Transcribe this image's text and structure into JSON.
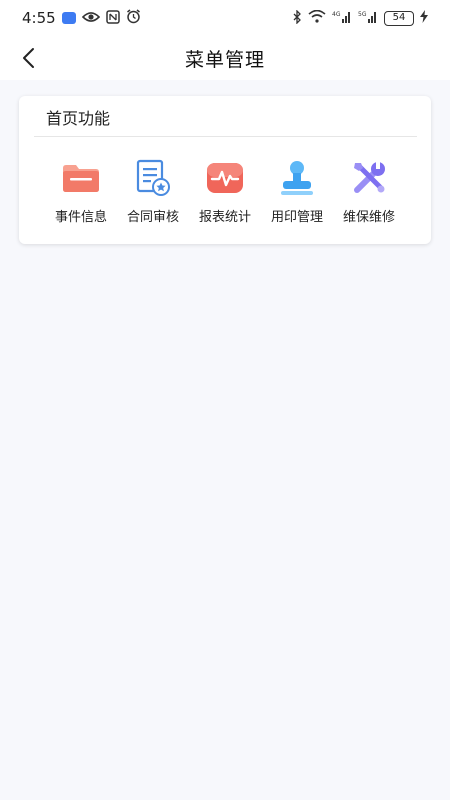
{
  "status_bar": {
    "time": "4:55",
    "battery": "54",
    "icons": [
      "app-notification-icon",
      "eye-icon",
      "nfc-icon",
      "alarm-icon",
      "bluetooth-icon",
      "wifi-icon",
      "signal-4g-icon",
      "signal-5g-icon",
      "charging-icon"
    ]
  },
  "nav": {
    "title": "菜单管理",
    "back_icon": "chevron-left-icon"
  },
  "section": {
    "title": "首页功能",
    "items": [
      {
        "label": "事件信息",
        "icon": "folder-icon",
        "color": "#f47c6b"
      },
      {
        "label": "合同审核",
        "icon": "contract-icon",
        "color": "#4a8be0"
      },
      {
        "label": "报表统计",
        "icon": "pulse-chart-icon",
        "color": "#f0665a"
      },
      {
        "label": "用印管理",
        "icon": "stamp-icon",
        "color": "#3ea2f0"
      },
      {
        "label": "维保维修",
        "icon": "tools-icon",
        "color": "#7d6ff0"
      }
    ]
  }
}
